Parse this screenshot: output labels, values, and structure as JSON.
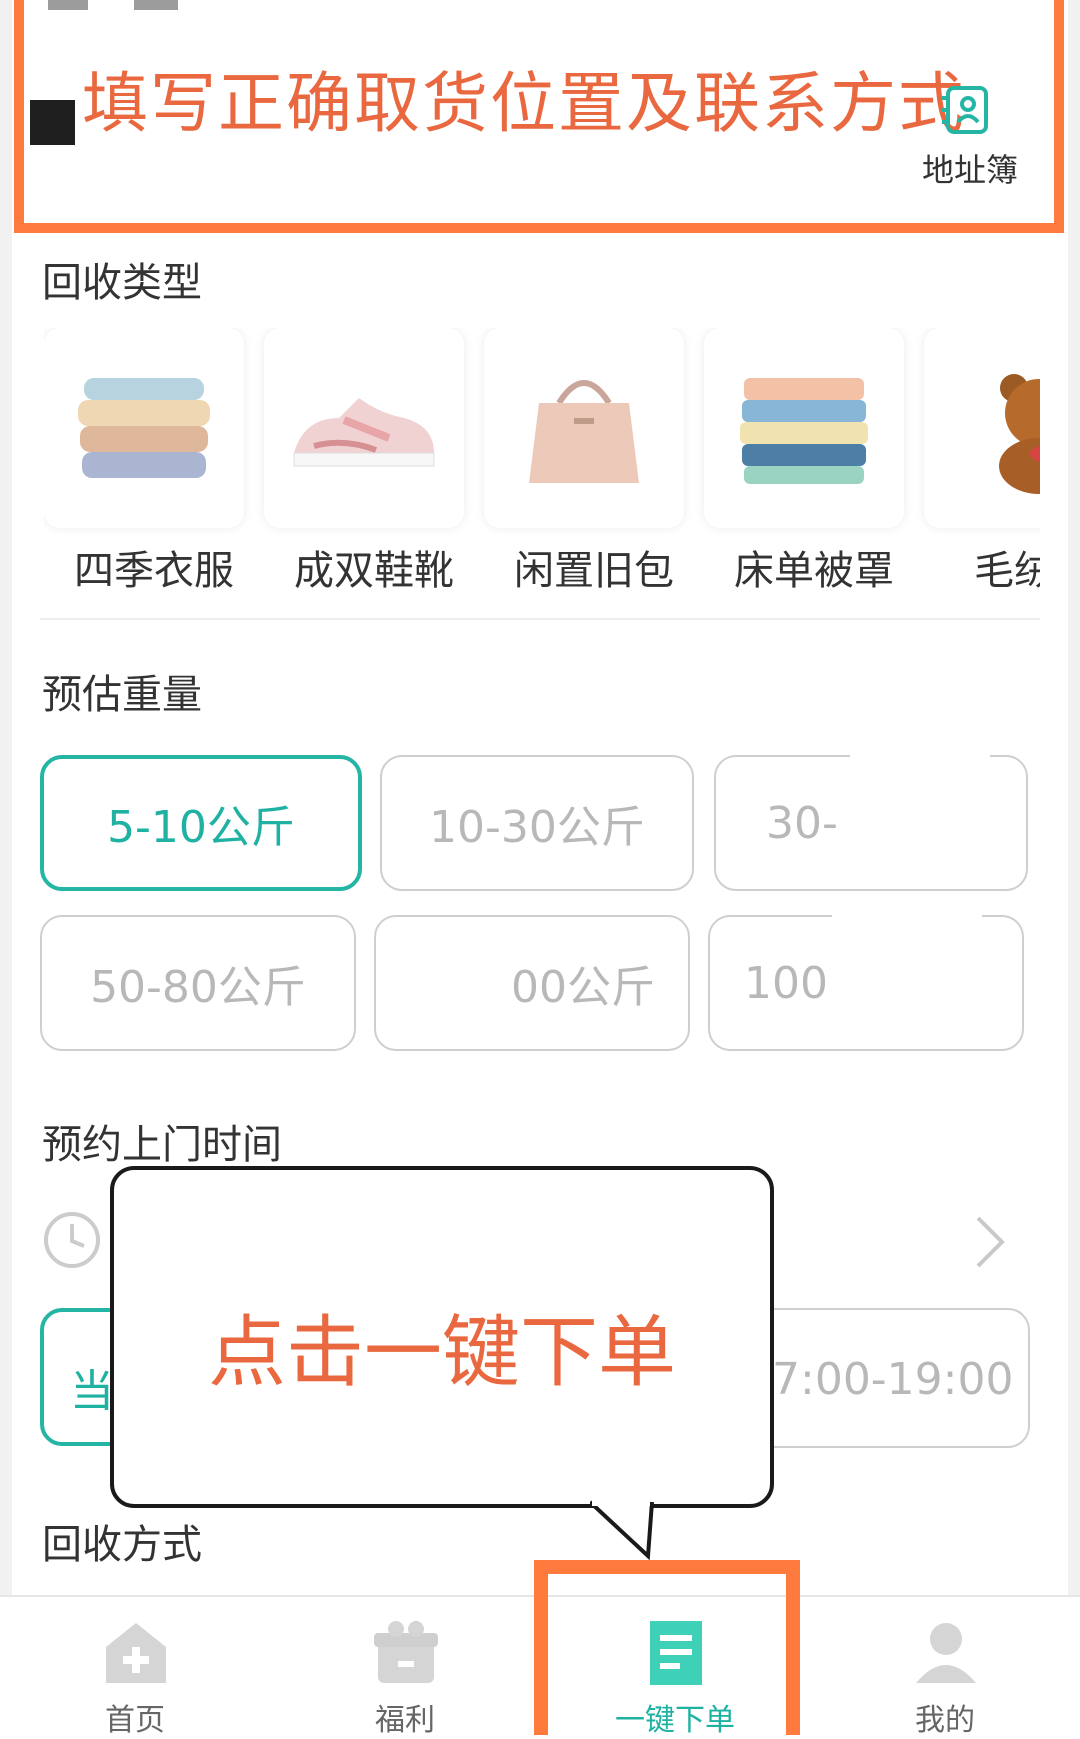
{
  "address": {
    "prompt": "填写正确取货位置及联系方式",
    "addressbook_label": "地址簿"
  },
  "recycle_type": {
    "title": "回收类型",
    "items": [
      {
        "label": "四季衣服",
        "icon": "folded-clothes"
      },
      {
        "label": "成双鞋靴",
        "icon": "sneaker"
      },
      {
        "label": "闲置旧包",
        "icon": "handbag"
      },
      {
        "label": "床单被罩",
        "icon": "folded-bedding"
      },
      {
        "label": "毛绒玩",
        "icon": "teddy-bear"
      }
    ]
  },
  "weight": {
    "title": "预估重量",
    "options": [
      {
        "label": "5-10公斤",
        "selected": true
      },
      {
        "label": "10-30公斤",
        "selected": false
      },
      {
        "label": "30-",
        "selected": false
      },
      {
        "label": "50-80公斤",
        "selected": false
      },
      {
        "label": "00公斤",
        "selected": false
      },
      {
        "label": "100",
        "selected": false
      }
    ]
  },
  "appointment": {
    "title": "预约上门时间",
    "slot_left": "当",
    "slot_right": "7:00-19:00"
  },
  "method": {
    "title": "回收方式"
  },
  "callout": {
    "text": "点击一键下单"
  },
  "nav": {
    "items": [
      {
        "label": "首页",
        "icon": "home-icon"
      },
      {
        "label": "福利",
        "icon": "gift-icon"
      },
      {
        "label": "一键下单",
        "icon": "order-icon",
        "active": true
      },
      {
        "label": "我的",
        "icon": "user-icon"
      }
    ]
  },
  "colors": {
    "accent": "#24b5a5",
    "annotation": "#ff7a3d",
    "annotation_text": "#e9683f"
  }
}
